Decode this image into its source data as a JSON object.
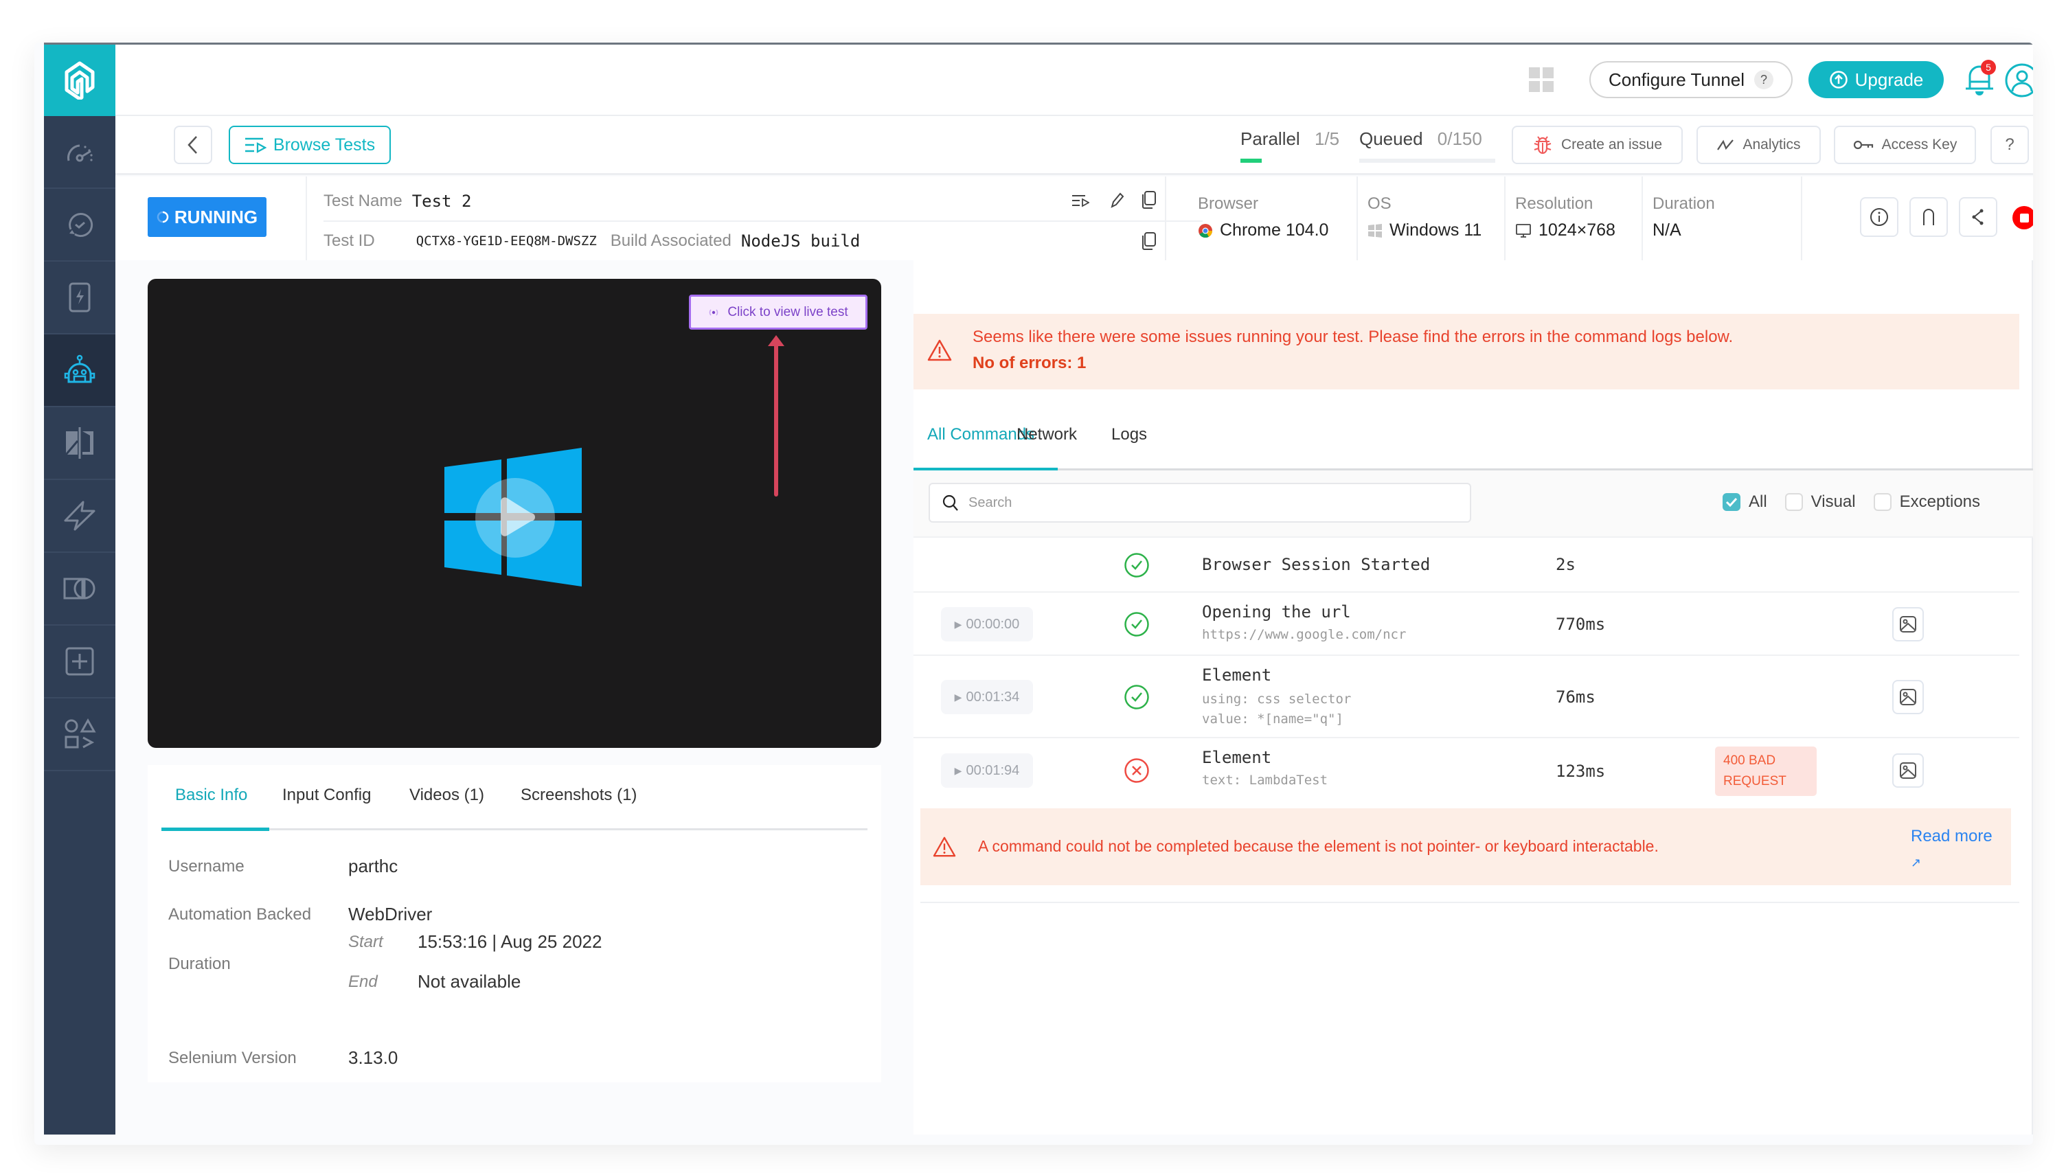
{
  "header": {
    "configure_tunnel": "Configure Tunnel",
    "tunnel_help": "?",
    "upgrade": "Upgrade",
    "notification_count": "5"
  },
  "toolbar": {
    "browse_tests": "Browse Tests",
    "parallel_label": "Parallel",
    "parallel_value": "1/5",
    "queued_label": "Queued",
    "queued_value": "0/150",
    "create_issue": "Create an issue",
    "analytics": "Analytics",
    "access_key": "Access Key",
    "help": "?"
  },
  "test": {
    "status": "RUNNING",
    "name_label": "Test Name",
    "name": "Test 2",
    "id_label": "Test ID",
    "id": "QCTX8-YGE1D-EEQ8M-DWSZZ",
    "build_label": "Build Associated",
    "build": "NodeJS build",
    "browser_label": "Browser",
    "browser": "Chrome 104.0",
    "os_label": "OS",
    "os": "Windows 11",
    "resolution_label": "Resolution",
    "resolution": "1024×768",
    "duration_label": "Duration",
    "duration": "N/A"
  },
  "video": {
    "live_button": "Click to view live test"
  },
  "info_tabs": [
    "Basic Info",
    "Input Config",
    "Videos (1)",
    "Screenshots (1)"
  ],
  "basic_info": {
    "username_label": "Username",
    "username": "parthc",
    "automation_label": "Automation Backed",
    "automation": "WebDriver",
    "duration_label": "Duration",
    "start_label": "Start",
    "start": "15:53:16 | Aug 25 2022",
    "end_label": "End",
    "end": "Not available",
    "selenium_label": "Selenium Version",
    "selenium": "3.13.0"
  },
  "error_banner": {
    "message": "Seems like there were some issues running your test. Please find the errors in the command logs below.",
    "count": "No of errors: 1"
  },
  "command_tabs": [
    "All Commands",
    "Network",
    "Logs"
  ],
  "filters": {
    "search_placeholder": "Search",
    "all": "All",
    "visual": "Visual",
    "exceptions": "Exceptions",
    "all_checked": true,
    "visual_checked": false,
    "exceptions_checked": false
  },
  "commands": [
    {
      "timestamp": "",
      "status": "success",
      "title": "Browser Session Started",
      "sub": [],
      "duration": "2s",
      "badge": ""
    },
    {
      "timestamp": "00:00:00",
      "status": "success",
      "title": "Opening the url",
      "sub": [
        "https://www.google.com/ncr"
      ],
      "duration": "770ms",
      "badge": ""
    },
    {
      "timestamp": "00:01:34",
      "status": "success",
      "title": "Element",
      "sub": [
        "using: css selector",
        "value: *[name=\"q\"]"
      ],
      "duration": "76ms",
      "badge": ""
    },
    {
      "timestamp": "00:01:94",
      "status": "error",
      "title": "Element",
      "sub": [
        "text: LambdaTest"
      ],
      "duration": "123ms",
      "badge": "400 BAD REQUEST"
    }
  ],
  "command_error": {
    "message": "A command could not be completed because the element is not pointer- or keyboard interactable.",
    "read_more": "Read more",
    "read_more_arrow": "↗"
  },
  "colors": {
    "brand": "#13b7c4",
    "running": "#1e8bef",
    "error": "#e8432d",
    "success": "#2db24a",
    "sidebar": "#2f3e55"
  }
}
